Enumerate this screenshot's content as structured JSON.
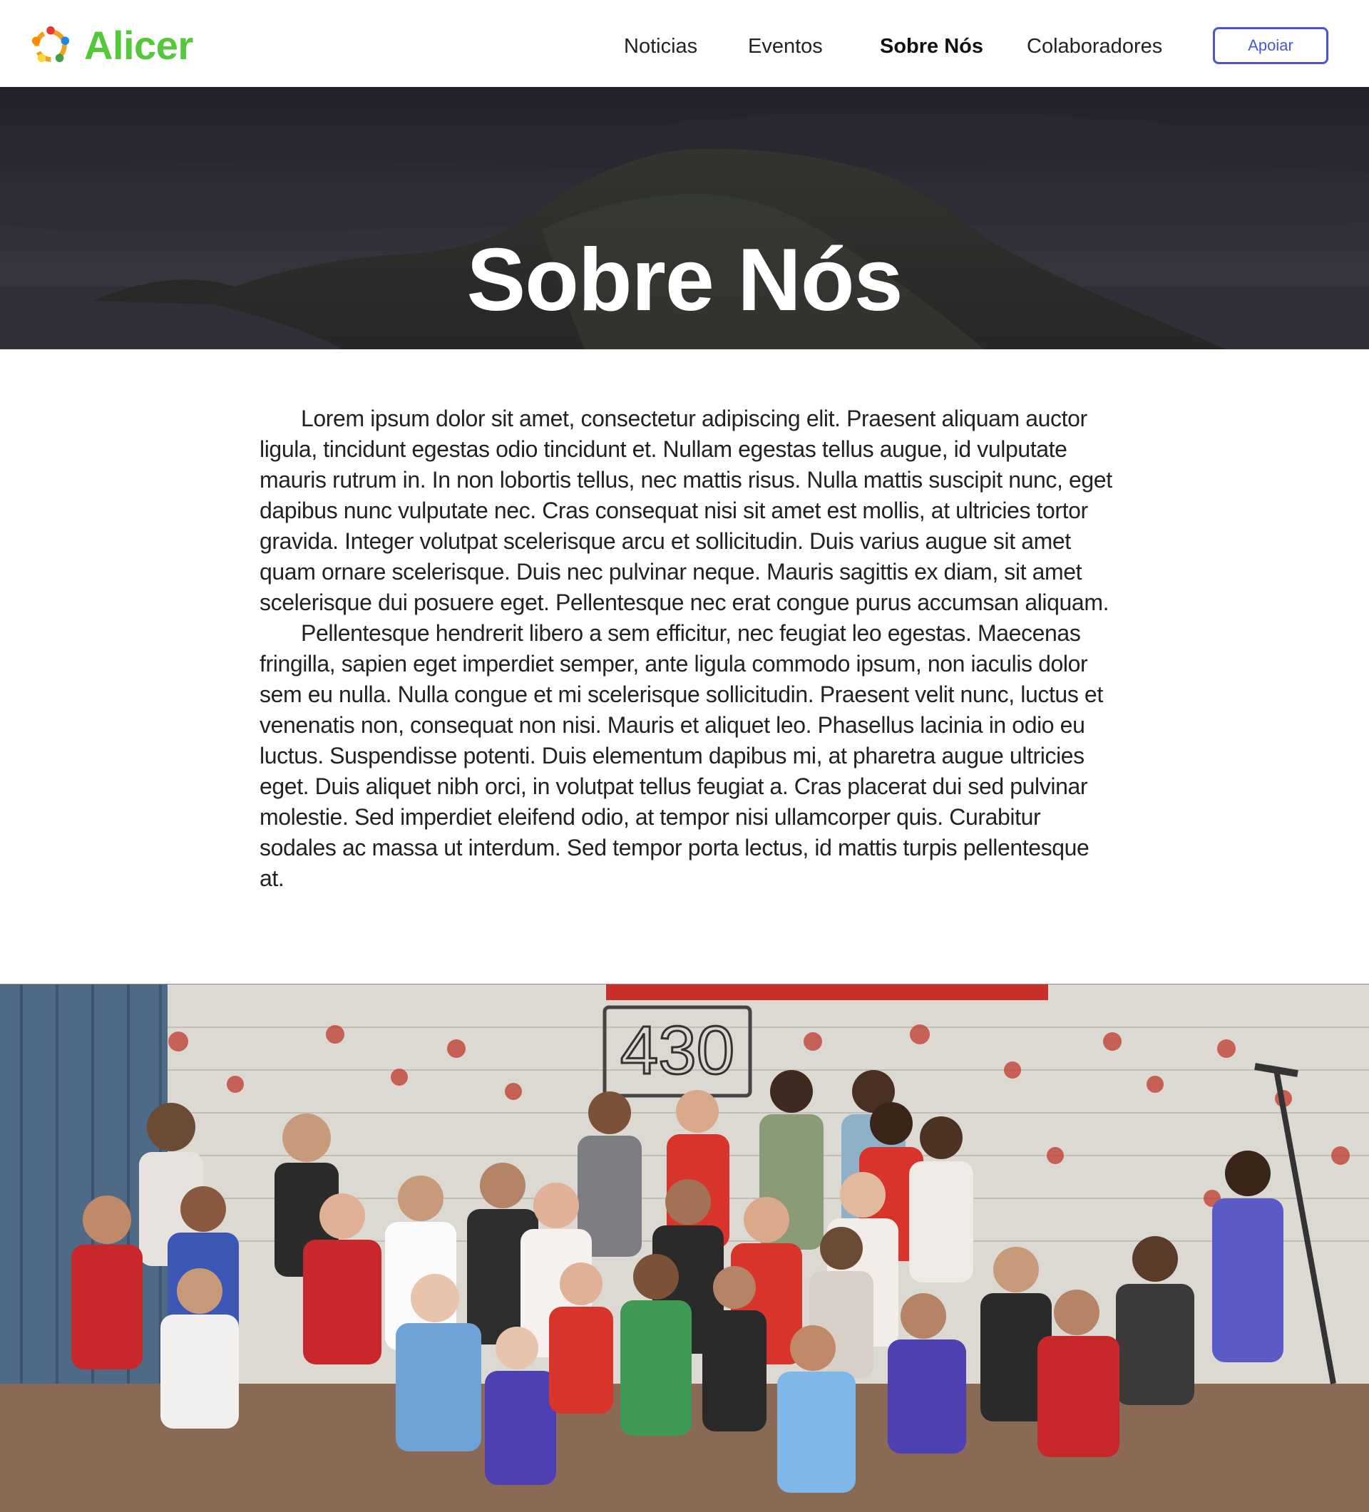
{
  "brand": {
    "name": "Alicer",
    "logo_icon": "people-circle-logo-icon",
    "color": "#52c83a"
  },
  "nav": {
    "items": [
      {
        "label": "Noticias",
        "active": false
      },
      {
        "label": "Eventos",
        "active": false
      },
      {
        "label": "Sobre Nós",
        "active": true
      },
      {
        "label": "Colaboradores",
        "active": false
      }
    ],
    "cta_label": "Apoiar",
    "cta_color": "#4a56d6"
  },
  "hero": {
    "title": "Sobre Nós"
  },
  "content": {
    "paragraphs": [
      "Lorem ipsum dolor sit amet, consectetur adipiscing elit. Praesent aliquam auctor ligula, tincidunt egestas odio tincidunt et. Nullam egestas tellus augue, id vulputate mauris rutrum in. In non lobortis tellus, nec mattis risus. Nulla mattis suscipit nunc, eget dapibus nunc vulputate nec. Cras consequat nisi sit amet est mollis, at ultricies tortor gravida. Integer volutpat scelerisque arcu et sollicitudin. Duis varius augue sit amet quam ornare scelerisque. Duis nec pulvinar neque. Mauris sagittis ex diam, sit amet scelerisque dui posuere eget. Pellentesque nec erat congue purus accumsan aliquam.",
      "Pellentesque hendrerit libero a sem efficitur, nec feugiat leo egestas. Maecenas fringilla, sapien eget imperdiet semper, ante ligula commodo ipsum, non iaculis dolor sem eu nulla. Nulla congue et mi scelerisque sollicitudin. Praesent velit nunc, luctus et venenatis non, consequat non nisi. Mauris et aliquet leo. Phasellus lacinia in odio eu luctus. Suspendisse potenti. Duis elementum dapibus mi, at pharetra augue ultricies eget. Duis aliquet nibh orci, in volutpat tellus feugiat a. Cras placerat dui sed pulvinar molestie. Sed imperdiet eleifend odio, at tempor nisi ullamcorper quis. Curabitur sodales ac massa ut interdum. Sed tempor porta lectus, id mattis turpis pellentesque at."
    ]
  },
  "photo": {
    "wall_number": "430"
  }
}
